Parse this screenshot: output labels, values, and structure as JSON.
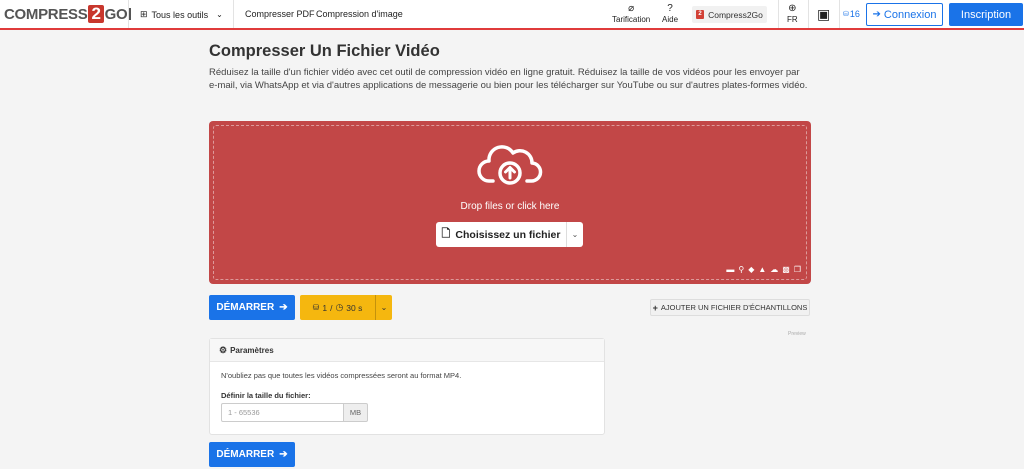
{
  "header": {
    "logo": {
      "left": "COMPRESS",
      "mid": "2",
      "right": "GO"
    },
    "tools_menu": "Tous les outils",
    "nav": [
      "Compresser PDF",
      "Compression d'image"
    ],
    "pricing": "Tarification",
    "help": "Aide",
    "compress2go": "Compress2Go",
    "language": "FR",
    "counter": "16",
    "login": "Connexion",
    "signup": "Inscription",
    "accent_color": "#e03b3b",
    "primary_color": "#1a73e8"
  },
  "main": {
    "title": "Compresser Un Fichier Vidéo",
    "description": "Réduisez la taille d'un fichier vidéo avec cet outil de compression vidéo en ligne gratuit. Réduisez la taille de vos vidéos pour les envoyer par e-mail, via WhatsApp et via d'autres applications de messagerie ou bien pour les télécharger sur YouTube ou sur d'autres plates-formes vidéo.",
    "dropzone": {
      "text": "Drop files or click here",
      "choose": "Choisissez un fichier",
      "color": "#c24747"
    },
    "start_label": "DÉMARRER",
    "limit": {
      "files": "1",
      "separator": "/",
      "time": "30 s"
    },
    "sample": "AJOUTER UN FICHIER D'ÉCHANTILLONS",
    "preview": "Preview"
  },
  "settings": {
    "title": "Paramètres",
    "note": "N'oubliez pas que toutes les vidéos compressées seront au format MP4.",
    "size_label": "Définir la taille du fichier:",
    "size_placeholder": "1 - 65536",
    "size_unit": "MB"
  }
}
